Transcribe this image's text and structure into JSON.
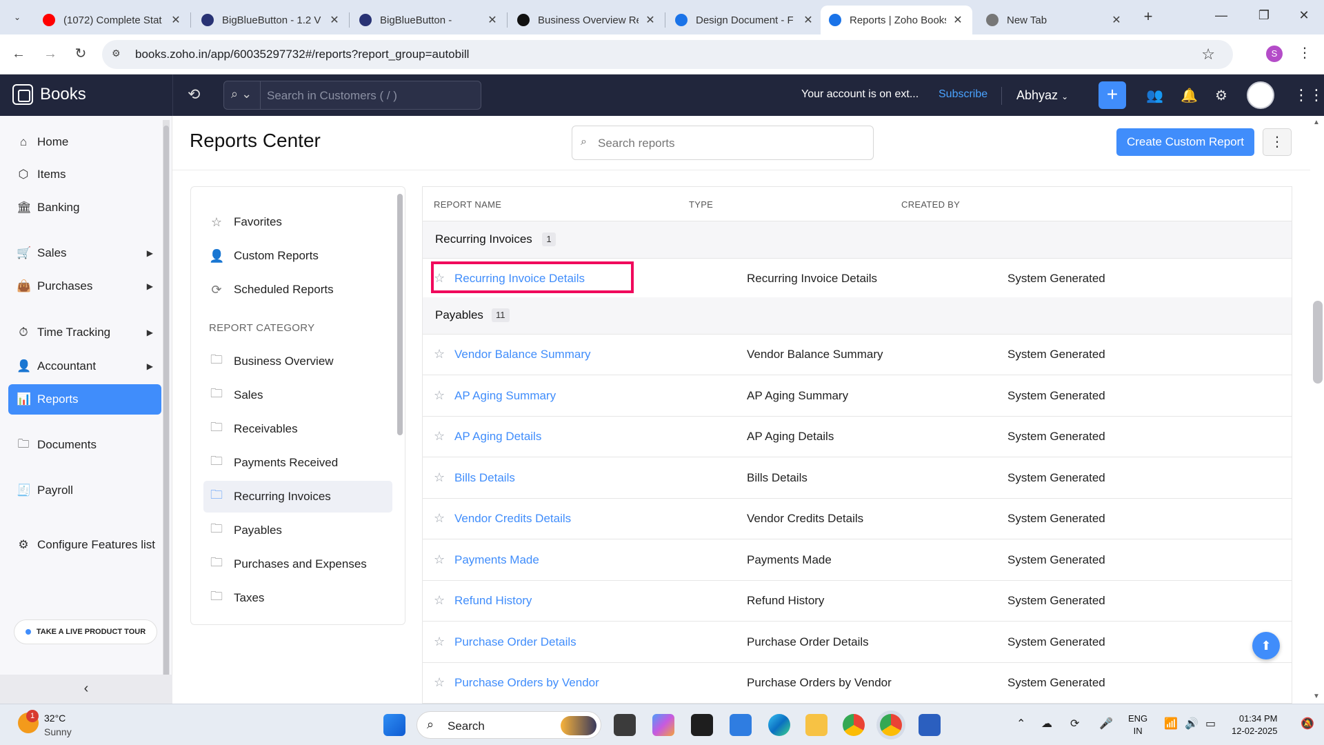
{
  "browser": {
    "tabs": [
      {
        "title": "(1072) Complete Stat",
        "favicon": "youtube-icon",
        "color": "#ff0000"
      },
      {
        "title": "BigBlueButton - 1.2 V",
        "favicon": "bigbluebutton-icon",
        "color": "#283274"
      },
      {
        "title": "BigBlueButton - ",
        "favicon": "bigbluebutton-icon",
        "color": "#283274"
      },
      {
        "title": "Business Overview Re",
        "favicon": "openai-icon",
        "color": "#111111"
      },
      {
        "title": "Design Document - F",
        "favicon": "document-icon",
        "color": "#1a73e8"
      },
      {
        "title": "Reports | Zoho Books",
        "favicon": "zoho-books-icon",
        "color": "#1a73e8"
      },
      {
        "title": "New Tab",
        "favicon": "chrome-icon",
        "color": "#777777"
      }
    ],
    "url": "books.zoho.in/app/60035297732#/reports?report_group=autobill",
    "profile_initial": "S"
  },
  "app": {
    "logo": "Books",
    "search_placeholder": "Search in Customers ( / )",
    "account_message": "Your account is on ext...",
    "subscribe_label": "Subscribe",
    "org_name": "Abhyaz"
  },
  "sidebar": {
    "items": [
      {
        "label": "Home",
        "icon": "home-icon"
      },
      {
        "label": "Items",
        "icon": "items-icon"
      },
      {
        "label": "Banking",
        "icon": "bank-icon"
      },
      {
        "label": "Sales",
        "icon": "cart-icon",
        "expandable": true
      },
      {
        "label": "Purchases",
        "icon": "bag-icon",
        "expandable": true
      },
      {
        "label": "Time Tracking",
        "icon": "timer-icon",
        "expandable": true
      },
      {
        "label": "Accountant",
        "icon": "accountant-icon",
        "expandable": true
      },
      {
        "label": "Reports",
        "icon": "reports-icon",
        "active": true
      },
      {
        "label": "Documents",
        "icon": "folder-icon"
      },
      {
        "label": "Payroll",
        "icon": "payroll-icon"
      },
      {
        "label": "Configure Features list",
        "icon": "configure-icon"
      }
    ],
    "tour_label": "TAKE A LIVE PRODUCT TOUR"
  },
  "reports": {
    "title": "Reports Center",
    "search_placeholder": "Search reports",
    "create_button": "Create Custom Report",
    "nav": [
      {
        "label": "Favorites",
        "icon": "star-icon"
      },
      {
        "label": "Custom Reports",
        "icon": "user-report-icon"
      },
      {
        "label": "Scheduled Reports",
        "icon": "scheduled-icon"
      }
    ],
    "category_heading": "REPORT CATEGORY",
    "categories": [
      "Business Overview",
      "Sales",
      "Receivables",
      "Payments Received",
      "Recurring Invoices",
      "Payables",
      "Purchases and Expenses",
      "Taxes"
    ],
    "active_category": "Recurring Invoices",
    "columns": {
      "name": "REPORT NAME",
      "type": "TYPE",
      "created_by": "CREATED BY"
    },
    "groups": [
      {
        "name": "Recurring Invoices",
        "count": "1",
        "rows": [
          {
            "name": "Recurring Invoice Details",
            "type": "Recurring Invoice Details",
            "created_by": "System Generated",
            "highlighted": true
          }
        ]
      },
      {
        "name": "Payables",
        "count": "11",
        "rows": [
          {
            "name": "Vendor Balance Summary",
            "type": "Vendor Balance Summary",
            "created_by": "System Generated"
          },
          {
            "name": "AP Aging Summary",
            "type": "AP Aging Summary",
            "created_by": "System Generated"
          },
          {
            "name": "AP Aging Details",
            "type": "AP Aging Details",
            "created_by": "System Generated"
          },
          {
            "name": "Bills Details",
            "type": "Bills Details",
            "created_by": "System Generated"
          },
          {
            "name": "Vendor Credits Details",
            "type": "Vendor Credits Details",
            "created_by": "System Generated"
          },
          {
            "name": "Payments Made",
            "type": "Payments Made",
            "created_by": "System Generated"
          },
          {
            "name": "Refund History",
            "type": "Refund History",
            "created_by": "System Generated"
          },
          {
            "name": "Purchase Order Details",
            "type": "Purchase Order Details",
            "created_by": "System Generated"
          },
          {
            "name": "Purchase Orders by Vendor",
            "type": "Purchase Orders by Vendor",
            "created_by": "System Generated"
          }
        ]
      }
    ]
  },
  "taskbar": {
    "weather_temp": "32°C",
    "weather_condition": "Sunny",
    "weather_badge": "1",
    "search_label": "Search",
    "language_line1": "ENG",
    "language_line2": "IN",
    "time": "01:34 PM",
    "date": "12-02-2025"
  },
  "colors": {
    "accent": "#408dfb",
    "highlight": "#f0095c",
    "appbar": "#21263c"
  }
}
